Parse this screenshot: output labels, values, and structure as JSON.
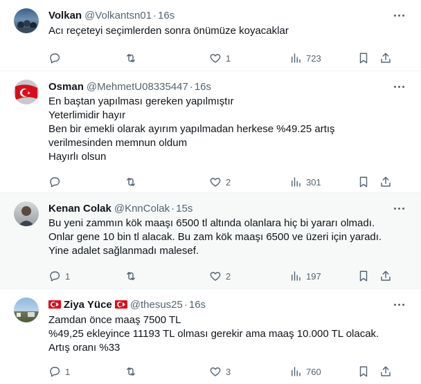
{
  "tweets": [
    {
      "name": "Volkan",
      "handle": "@Volkantsn01",
      "dot": "·",
      "time": "16s",
      "lines": [
        "Acı reçeteyi seçimlerden sonra önümüze koyacaklar"
      ],
      "replies": "",
      "retweets": "",
      "likes": "1",
      "views": "723"
    },
    {
      "name": "Osman",
      "handle": "@MehmetU08335447",
      "dot": "·",
      "time": "16s",
      "lines": [
        "En baştan yapılması gereken yapılmıştır",
        "Yeterlimidir hayır",
        "Ben bir emekli olarak ayırım yapılmadan herkese %49.25 artış",
        "verilmesinden memnun oldum",
        "Hayırlı olsun"
      ],
      "replies": "",
      "retweets": "",
      "likes": "2",
      "views": "301"
    },
    {
      "name": "Kenan Colak",
      "handle": "@KnnColak",
      "dot": "·",
      "time": "15s",
      "lines": [
        "Bu yeni zammın kök maaşı 6500 tl altında  olanlara hiç bi yararı olmadı.",
        "Onlar gene 10 bin tl alacak. Bu zam kök maaşı 6500 ve üzeri için yaradı.",
        "Yine adalet sağlanmadı malesef."
      ],
      "replies": "1",
      "retweets": "",
      "likes": "2",
      "views": "197"
    },
    {
      "name": "Ziya Yüce",
      "handle": "@thesus25",
      "dot": "·",
      "time": "16s",
      "lines": [
        "Zamdan önce maaş 7500 TL",
        "%49,25 ekleyince 11193 TL olması gerekir ama maaş 10.000 TL olacak.",
        "Artış oranı %33"
      ],
      "replies": "1",
      "retweets": "",
      "likes": "3",
      "views": "760"
    }
  ]
}
